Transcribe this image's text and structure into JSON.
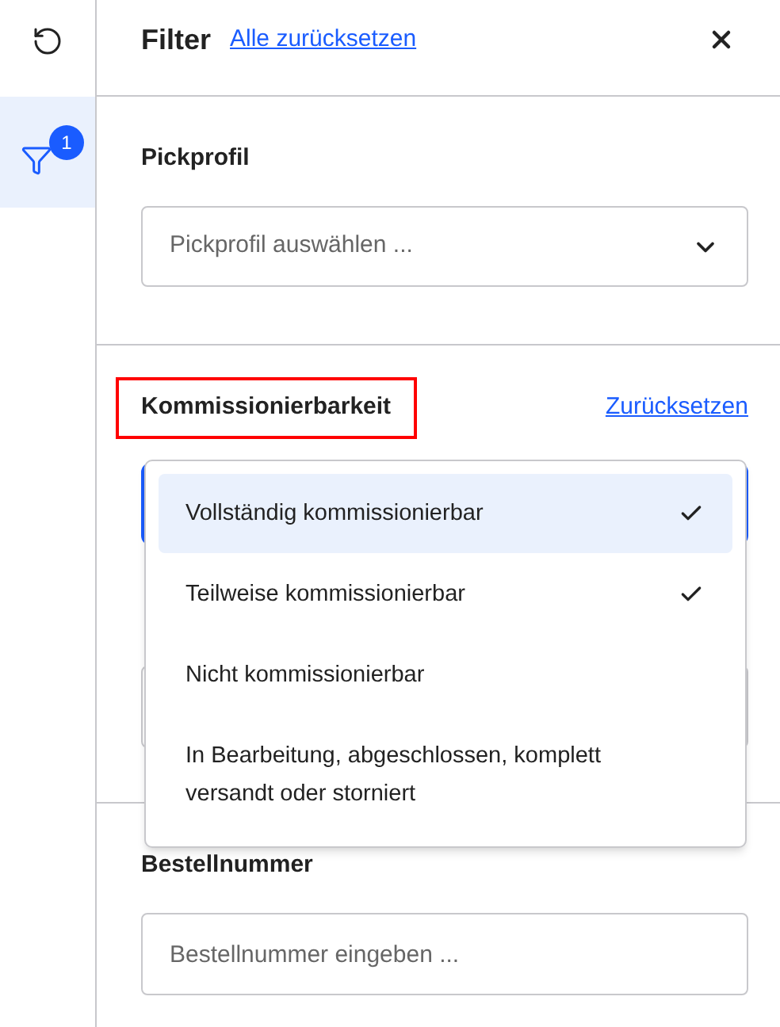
{
  "rail": {
    "items": [
      {
        "kind": "undo",
        "selected": false
      },
      {
        "kind": "filter",
        "selected": true,
        "badge": "1"
      }
    ]
  },
  "header": {
    "title": "Filter",
    "reset_all": "Alle zurücksetzen"
  },
  "pickprofil": {
    "label": "Pickprofil",
    "placeholder": "Pickprofil auswählen ..."
  },
  "kommissionierbarkeit": {
    "label": "Kommissionierbarkeit",
    "highlighted": true,
    "reset": "Zurücksetzen",
    "options": [
      {
        "label": "Vollständig kommissionierbar",
        "checked": true,
        "selected": true
      },
      {
        "label": "Teilweise kommissionierbar",
        "checked": true,
        "selected": false
      },
      {
        "label": "Nicht kommissionierbar",
        "checked": false,
        "selected": false
      },
      {
        "label": "In Bearbeitung, abgeschlossen, komplett versandt oder storniert",
        "checked": false,
        "selected": false
      }
    ]
  },
  "bestellnummer": {
    "label": "Bestellnummer",
    "placeholder": "Bestellnummer eingeben ..."
  }
}
